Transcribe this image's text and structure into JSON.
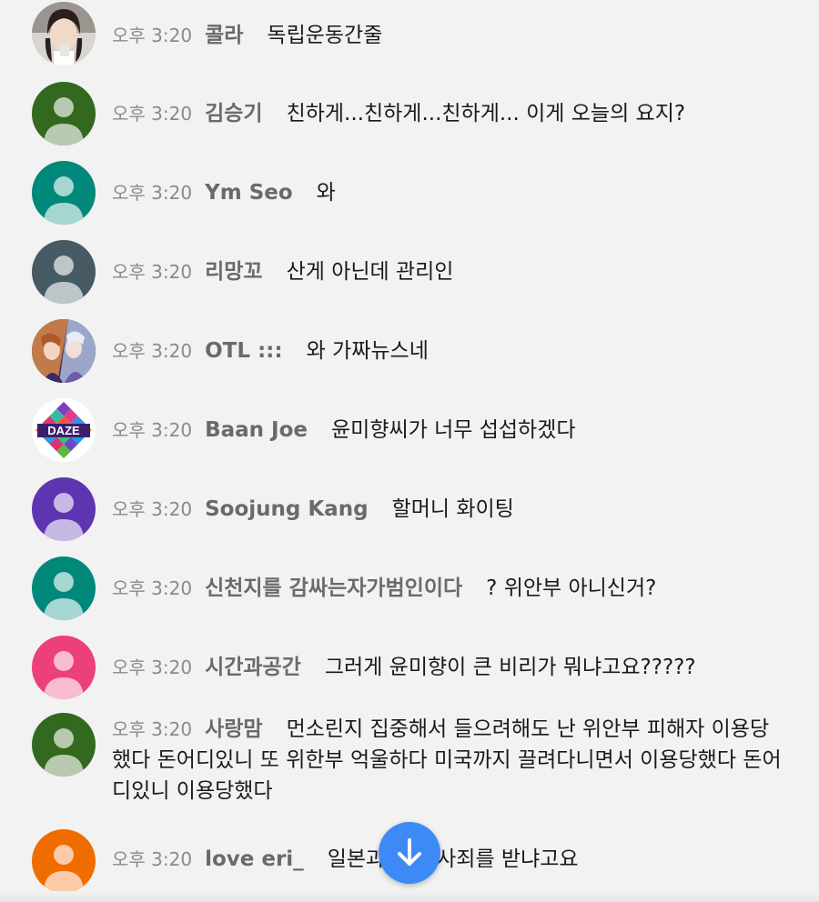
{
  "messages": [
    {
      "time": "오후 3:20",
      "author": "콜라",
      "text": "독립운동간줄",
      "avatar": "photo-woman",
      "color": "#2c2c2c"
    },
    {
      "time": "오후 3:20",
      "author": "김승기",
      "text": "친하게...친하게...친하게... 이게 오늘의 요지?",
      "avatar": "default",
      "color": "#33691e"
    },
    {
      "time": "오후 3:20",
      "author": "Ym Seo",
      "text": "와",
      "avatar": "default",
      "color": "#00897b"
    },
    {
      "time": "오후 3:20",
      "author": "리망꼬",
      "text": "산게 아닌데 관리인",
      "avatar": "default",
      "color": "#455a64"
    },
    {
      "time": "오후 3:20",
      "author": "OTL :::",
      "text": "와 가짜뉴스네",
      "avatar": "photo-anime",
      "color": "#7b4a7a"
    },
    {
      "time": "오후 3:20",
      "author": "Baan Joe",
      "text": "윤미향씨가 너무 섭섭하겠다",
      "avatar": "daze-logo",
      "logo_text": "DAZE",
      "color": "#ffffff"
    },
    {
      "time": "오후 3:20",
      "author": "Soojung Kang",
      "text": "할머니 화이팅",
      "avatar": "default",
      "color": "#5e35b1"
    },
    {
      "time": "오후 3:20",
      "author": "신천지를 감싸는자가범인이다",
      "text": "? 위안부 아니신거?",
      "avatar": "default",
      "color": "#00897b"
    },
    {
      "time": "오후 3:20",
      "author": "시간과공간",
      "text": "그러게 윤미향이 큰 비리가 뭐냐고요?????",
      "avatar": "default",
      "color": "#ec407a"
    },
    {
      "time": "오후 3:20",
      "author": "사랑맘",
      "text": "먼소린지 집중해서 들으려해도 난 위안부 피해자 이용당했다 돈어디있니 또 위한부 억울하다 미국까지 끌려다니면서 이용당했다 돈어디있니 이용당했다",
      "avatar": "default",
      "color": "#33691e"
    },
    {
      "time": "오후 3:20",
      "author": "love eri_",
      "text": "일본과 하면 사죄를 받냐고요",
      "avatar": "default",
      "color": "#ef6c00"
    }
  ],
  "scroll_button": {
    "icon": "arrow-down-icon",
    "color": "#3d8af7"
  }
}
